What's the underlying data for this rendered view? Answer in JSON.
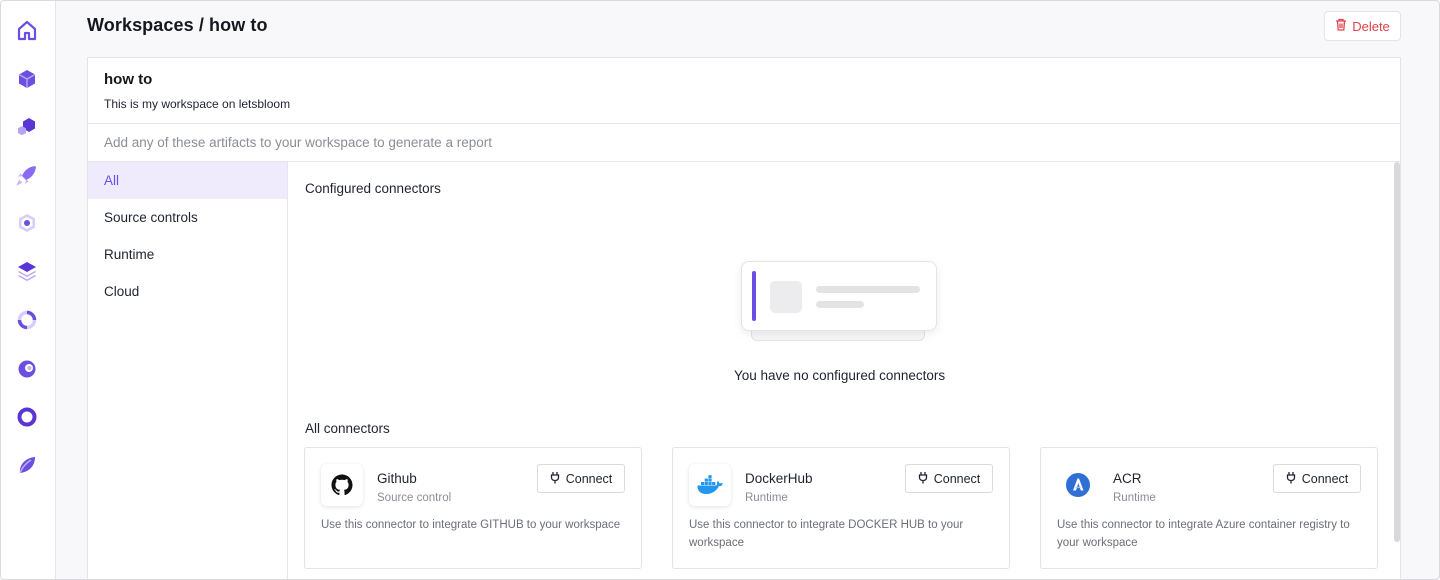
{
  "sidebar": {
    "items": [
      {
        "icon": "home-icon"
      },
      {
        "icon": "cube-icon"
      },
      {
        "icon": "hexagon-group-icon"
      },
      {
        "icon": "rocket-icon"
      },
      {
        "icon": "hex-target-icon"
      },
      {
        "icon": "layers-icon"
      },
      {
        "icon": "spinner-ring-icon"
      },
      {
        "icon": "swirl-icon"
      },
      {
        "icon": "ring-icon"
      },
      {
        "icon": "leaf-icon"
      }
    ]
  },
  "header": {
    "breadcrumb": "Workspaces / how to",
    "delete_label": "Delete"
  },
  "workspace": {
    "name": "how to",
    "description": "This is my workspace on letsbloom",
    "hint": "Add any of these artifacts to your workspace to generate a report"
  },
  "categories": [
    {
      "label": "All"
    },
    {
      "label": "Source controls"
    },
    {
      "label": "Runtime"
    },
    {
      "label": "Cloud"
    }
  ],
  "configured": {
    "title": "Configured connectors",
    "empty_message": "You have no configured connectors"
  },
  "all_connectors": {
    "title": "All connectors",
    "items": [
      {
        "name": "Github",
        "type": "Source control",
        "button_label": "Connect",
        "description": "Use this connector to integrate GITHUB to your workspace"
      },
      {
        "name": "DockerHub",
        "type": "Runtime",
        "button_label": "Connect",
        "description": "Use this connector to integrate DOCKER HUB to your workspace"
      },
      {
        "name": "ACR",
        "type": "Runtime",
        "button_label": "Connect",
        "description": "Use this connector to integrate Azure container registry to your workspace"
      }
    ]
  },
  "colors": {
    "accent": "#6b4fe0",
    "active_bg": "#efebfc",
    "delete": "#e0434a",
    "border": "#e3e3e8"
  }
}
